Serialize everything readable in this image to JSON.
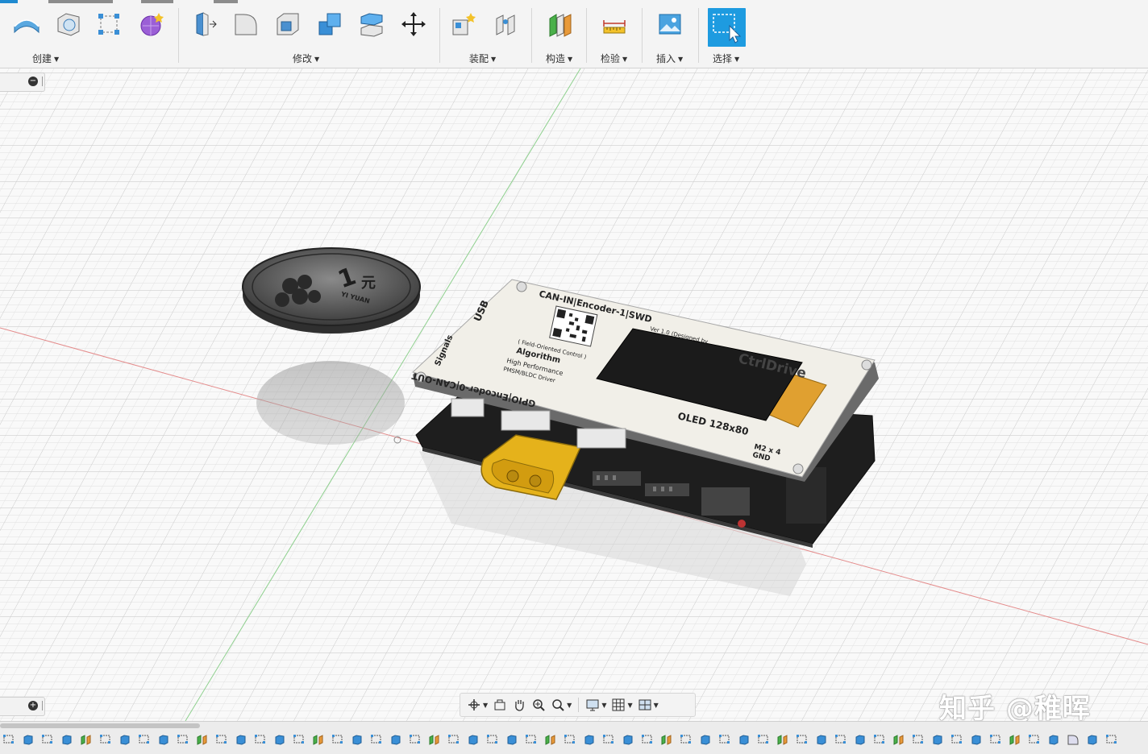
{
  "ribbon": {
    "groups": [
      {
        "label": "创建",
        "tools": [
          "sketch-arc-icon",
          "box-icon",
          "rectangle-sketch-icon",
          "form-sphere-icon"
        ]
      },
      {
        "label": "修改",
        "tools": [
          "press-pull-icon",
          "fillet-icon",
          "shell-icon",
          "combine-icon",
          "split-body-icon",
          "move-icon"
        ]
      },
      {
        "label": "装配",
        "tools": [
          "new-component-icon",
          "joint-icon"
        ]
      },
      {
        "label": "构造",
        "tools": [
          "offset-plane-icon"
        ]
      },
      {
        "label": "检验",
        "tools": [
          "measure-icon"
        ]
      },
      {
        "label": "插入",
        "tools": [
          "insert-image-icon"
        ]
      },
      {
        "label": "选择",
        "tools": [
          "select-icon"
        ],
        "active": true
      }
    ]
  },
  "panels": {
    "top_toggle": "−",
    "bottom_toggle": "+"
  },
  "scene": {
    "coin_text": "1",
    "coin_char": "元",
    "coin_sub": "YI YUAN",
    "board_top_label": "CAN-IN|Encoder-1|SWD",
    "board_bottom_label": "GPIO|Encoder-0|CAN-OUT",
    "board_usb": "USB",
    "board_signals": "Signals",
    "board_algorithm": "Algorithm",
    "board_foc": "( Field-Oriented Control )",
    "board_high": "High Performance",
    "board_pmsm": "PMSM/BLDC Driver",
    "board_version": "Ver 1.0 (Designed by",
    "board_brand": "CtrlDrive",
    "board_oled": "OLED 128x80",
    "board_m2": "M2 x 4",
    "board_gnd": "GND",
    "colors": {
      "pcb_white": "#f1efe8",
      "pcb_black": "#232323",
      "connector_yellow": "#e5b21b",
      "oled_black": "#1b1b1b",
      "flex_orange": "#e0a030",
      "accent": "#1e9be0"
    }
  },
  "watermark": "知乎 @稚晖",
  "timeline": {
    "items": [
      "sketch",
      "extrude",
      "sketch",
      "extrude",
      "joint",
      "sketch",
      "extrude",
      "sketch",
      "extrude",
      "sketch",
      "joint",
      "sketch",
      "extrude",
      "sketch",
      "extrude",
      "sketch",
      "joint",
      "sketch",
      "extrude",
      "sketch",
      "extrude",
      "sketch",
      "joint",
      "sketch",
      "extrude",
      "sketch",
      "extrude",
      "sketch",
      "joint",
      "sketch",
      "extrude",
      "sketch",
      "extrude",
      "sketch",
      "joint",
      "sketch",
      "extrude",
      "sketch",
      "extrude",
      "sketch",
      "joint",
      "sketch",
      "extrude",
      "sketch",
      "extrude",
      "sketch",
      "joint",
      "sketch",
      "extrude",
      "sketch",
      "extrude",
      "sketch",
      "joint",
      "sketch",
      "extrude",
      "fillet",
      "extrude",
      "sketch"
    ]
  }
}
